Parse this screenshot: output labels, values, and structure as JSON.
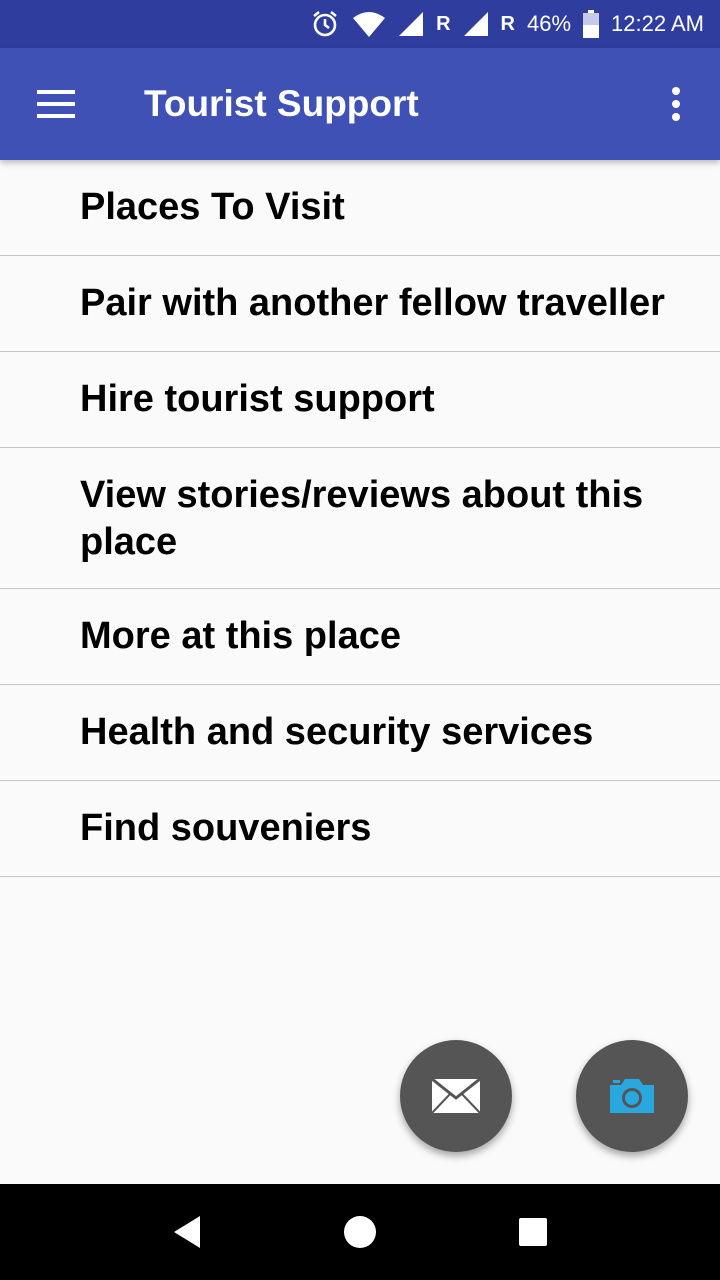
{
  "status_bar": {
    "network_label_1": "R",
    "network_label_2": "R",
    "battery": "46%",
    "time": "12:22 AM",
    "icons": [
      "alarm-icon",
      "wifi-icon",
      "signal-icon",
      "signal-icon",
      "battery-icon"
    ]
  },
  "app_bar": {
    "title": "Tourist Support",
    "menu_icon": "hamburger-menu-icon",
    "overflow_icon": "overflow-menu-icon",
    "color": "#3f51b5"
  },
  "menu_items": [
    "Places To Visit",
    "Pair with another fellow traveller",
    "Hire tourist support",
    "View stories/reviews about this place",
    "More at this place",
    "Health and security services",
    "Find souveniers"
  ],
  "fabs": {
    "mail_icon": "mail-icon",
    "camera_icon": "camera-icon",
    "camera_color": "#29a8e0"
  },
  "nav_bar": {
    "icons": [
      "back-icon",
      "home-icon",
      "recents-icon"
    ]
  }
}
